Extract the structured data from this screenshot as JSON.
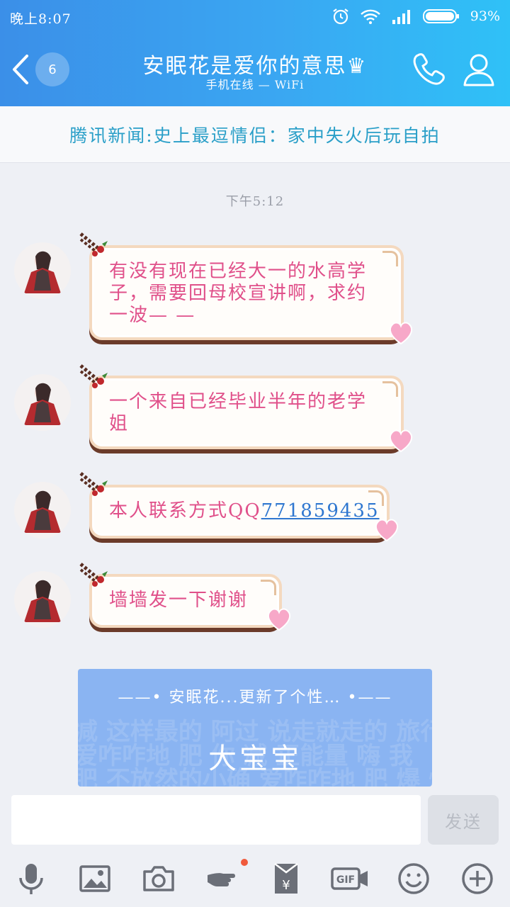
{
  "status": {
    "time": "晚上8:07",
    "battery": "93%"
  },
  "header": {
    "back_count": "6",
    "title": "安眠花是爱你的意思♛",
    "subtitle": "手机在线 — WiFi"
  },
  "news": {
    "text": "腾讯新闻:史上最逗情侣：家中失火后玩自拍"
  },
  "timestamp": "下午5:12",
  "messages": [
    {
      "text": "有没有现在已经大一的水高学子，需要回母校宣讲啊，求约一波— —"
    },
    {
      "text": "一个来自已经毕业半年的老学姐"
    },
    {
      "prefix": "本人联系方式QQ",
      "link": "771859435"
    },
    {
      "text": "墙墙发一下谢谢"
    }
  ],
  "card": {
    "header": "——• 安眠花...更新了个性… •——",
    "signature": "大宝宝",
    "background_text": [
      "减 这样最的 阿过 说走就走的 旅行 我需 要  哦我",
      "爱咋咋地 肥 你 减 正能量 嗨 我",
      "肥 不放然的小确 爱咋咋地 肥 爆 燥 爆起来"
    ]
  },
  "input": {
    "value": "",
    "send_label": "发送"
  },
  "toolbar": [
    "mic-icon",
    "image-icon",
    "camera-icon",
    "poke-icon",
    "red-packet-icon",
    "gif-icon",
    "emoji-icon",
    "plus-icon"
  ],
  "colors": {
    "header_start": "#3b8fe8",
    "header_end": "#2fc1f7",
    "bubble_text": "#e0508a",
    "link": "#2f77d0",
    "news_text": "#2a9fc8"
  }
}
